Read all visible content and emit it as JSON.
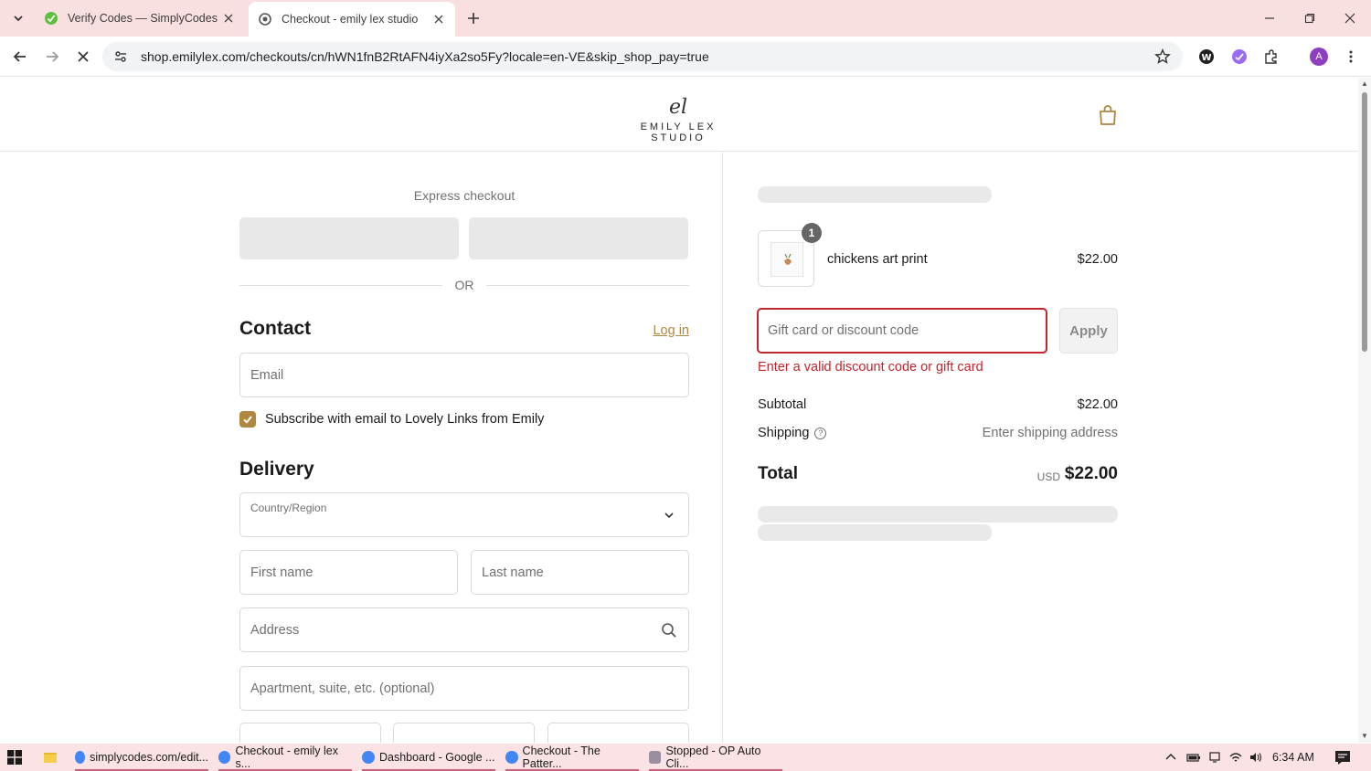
{
  "browser": {
    "tabs": [
      {
        "title": "Verify Codes — SimplyCodes",
        "active": false
      },
      {
        "title": "Checkout - emily lex studio",
        "active": true
      }
    ],
    "url": "shop.emilylex.com/checkouts/cn/hWN1fnB2RtAFN4iyXa2so5Fy?locale=en-VE&skip_shop_pay=true",
    "profile_initial": "A"
  },
  "header": {
    "logo_mark": "el",
    "logo_text": "EMILY LEX STUDIO"
  },
  "checkout": {
    "express_title": "Express checkout",
    "or_text": "OR",
    "contact": {
      "heading": "Contact",
      "login_label": "Log in",
      "email_placeholder": "Email",
      "subscribe_label": "Subscribe with email to Lovely Links from Emily",
      "subscribe_checked": true
    },
    "delivery": {
      "heading": "Delivery",
      "country_label": "Country/Region",
      "country_value": "",
      "first_name_placeholder": "First name",
      "last_name_placeholder": "Last name",
      "address_placeholder": "Address",
      "apartment_placeholder": "Apartment, suite, etc. (optional)"
    }
  },
  "summary": {
    "item": {
      "name": "chickens art print",
      "price": "$22.00",
      "quantity": "1"
    },
    "discount_placeholder": "Gift card or discount code",
    "apply_label": "Apply",
    "error": "Enter a valid discount code or gift card",
    "subtotal_label": "Subtotal",
    "subtotal_value": "$22.00",
    "shipping_label": "Shipping",
    "shipping_value": "Enter shipping address",
    "total_label": "Total",
    "total_currency": "USD",
    "total_value": "$22.00"
  },
  "taskbar": {
    "items": [
      "simplycodes.com/edit...",
      "Checkout - emily lex s...",
      "Dashboard - Google ...",
      "Checkout - The Patter...",
      "Stopped - OP Auto Cli..."
    ],
    "time": "6:34 AM"
  },
  "colors": {
    "accent": "#b0873e",
    "error": "#c4242b",
    "tabbar": "#f9dfe0"
  }
}
